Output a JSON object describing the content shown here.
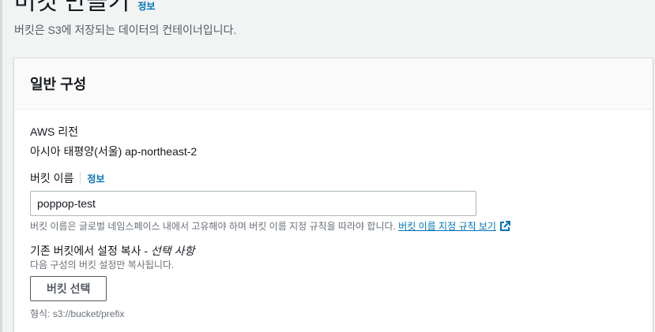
{
  "header": {
    "title": "버킷 만들기",
    "info_link": "정보",
    "description": "버킷은 S3에 저장되는 데이터의 컨테이너입니다."
  },
  "general": {
    "title": "일반 구성",
    "region_label": "AWS 리전",
    "region_value": "아시아 태평양(서울) ap-northeast-2",
    "bucket_name_label": "버킷 이름",
    "bucket_name_info": "정보",
    "bucket_name_value": "poppop-test",
    "bucket_name_hint": "버킷 이름은 글로벌 네임스페이스 내에서 고유해야 하며 버킷 이름 지정 규칙을 따라야 합니다.",
    "rules_link": "버킷 이름 지정 규칙 보기",
    "copy_label": "기존 버킷에서 설정 복사 - ",
    "copy_optional": "선택 사항",
    "copy_desc": "다음 구성의 버킷 설정만 복사됩니다.",
    "choose_bucket_button": "버킷 선택",
    "format_hint": "형식: s3://bucket/prefix"
  },
  "colors": {
    "link": "#0073bb",
    "background": "#f2f3f3",
    "panel": "#ffffff",
    "border": "#d5dbdb"
  },
  "icons": {
    "external_link": "external-link-icon"
  }
}
